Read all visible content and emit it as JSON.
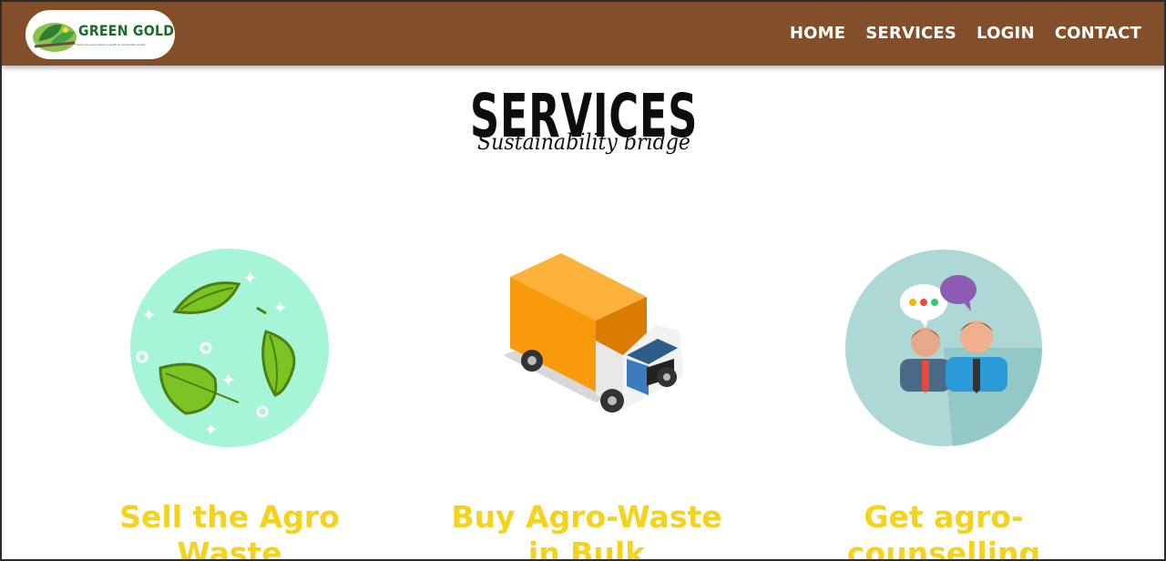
{
  "navbar": {
    "logo_text": "GREEN GOLD",
    "logo_tagline": "Transforming agro-waste to wealth for Sustainable Growth",
    "links": [
      "HOME",
      "SERVICES",
      "LOGIN",
      "CONTACT"
    ]
  },
  "section": {
    "title": "SERVICES",
    "subtitle": "Sustainability bridge"
  },
  "services": [
    {
      "icon": "leaves-icon",
      "title": "Sell the Agro Waste"
    },
    {
      "icon": "truck-icon",
      "title": "Buy Agro-Waste in Bulk"
    },
    {
      "icon": "counselling-icon",
      "title": "Get agro-counselling"
    }
  ],
  "colors": {
    "navbar_bg": "#834e2a",
    "service_title": "#f5d21d",
    "leaf_circle": "#a6f5d6",
    "truck_cargo": "#f89a0c",
    "counsel_circle": "#aed8d6"
  }
}
